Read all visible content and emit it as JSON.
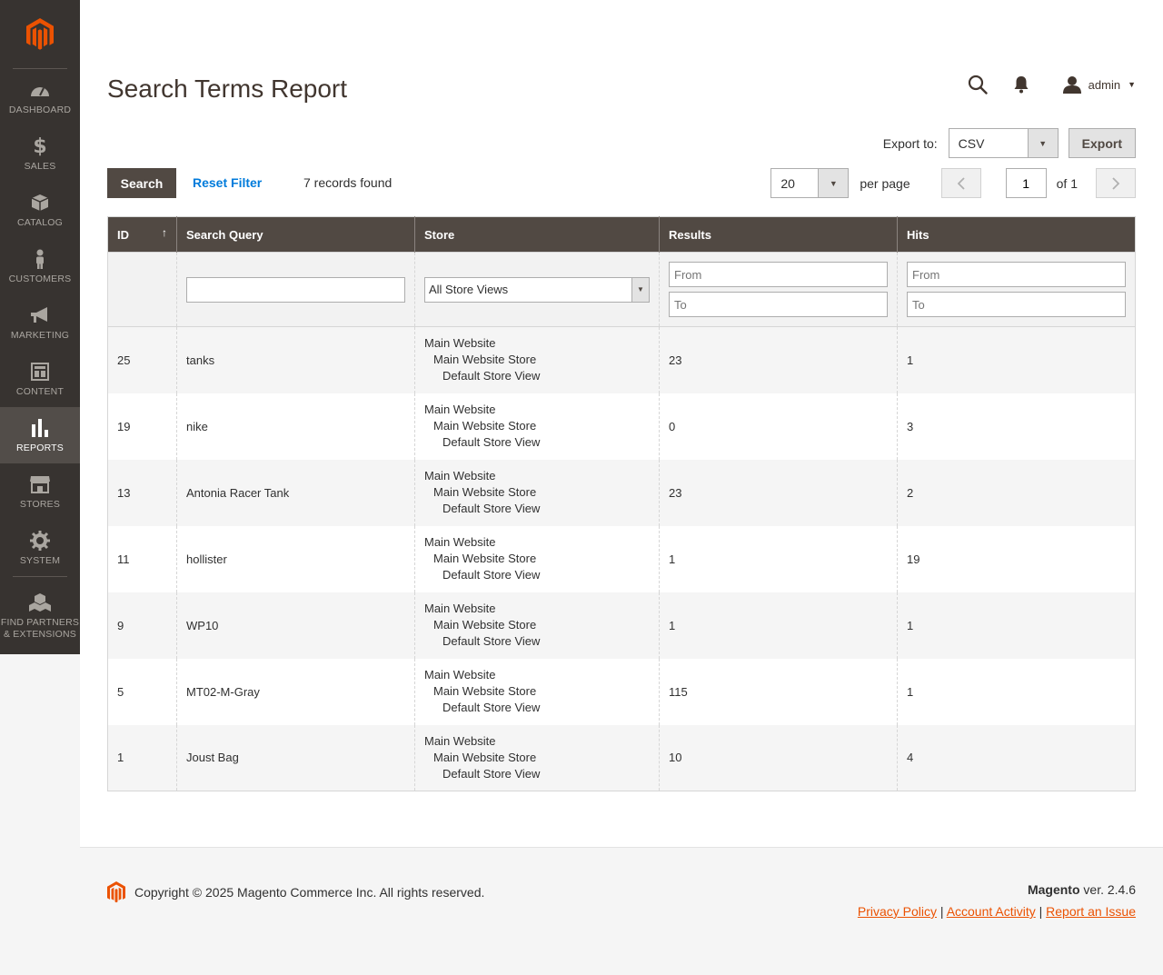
{
  "sidebar": {
    "items": [
      {
        "label": "Dashboard",
        "icon": "dashboard-icon"
      },
      {
        "label": "Sales",
        "icon": "dollar-icon"
      },
      {
        "label": "Catalog",
        "icon": "box-icon"
      },
      {
        "label": "Customers",
        "icon": "person-icon"
      },
      {
        "label": "Marketing",
        "icon": "megaphone-icon"
      },
      {
        "label": "Content",
        "icon": "layout-icon"
      },
      {
        "label": "Reports",
        "icon": "bar-chart-icon",
        "active": true
      },
      {
        "label": "Stores",
        "icon": "storefront-icon"
      },
      {
        "label": "System",
        "icon": "gear-icon"
      },
      {
        "label": "Find Partners & Extensions",
        "icon": "cubes-icon"
      }
    ]
  },
  "header": {
    "title": "Search Terms Report",
    "user": "admin"
  },
  "export": {
    "label": "Export to:",
    "format": "CSV",
    "button": "Export"
  },
  "toolbar": {
    "search_button": "Search",
    "reset_filter": "Reset Filter",
    "records_found": "7 records found",
    "per_page_value": "20",
    "per_page_label": "per page",
    "page_value": "1",
    "of_label": "of 1"
  },
  "grid": {
    "columns": [
      "ID",
      "Search Query",
      "Store",
      "Results",
      "Hits"
    ],
    "filters": {
      "store": "All Store Views",
      "from_placeholder": "From",
      "to_placeholder": "To"
    },
    "rows": [
      {
        "id": "25",
        "query": "tanks",
        "store": [
          "Main Website",
          "Main Website Store",
          "Default Store View"
        ],
        "results": "23",
        "hits": "1"
      },
      {
        "id": "19",
        "query": "nike",
        "store": [
          "Main Website",
          "Main Website Store",
          "Default Store View"
        ],
        "results": "0",
        "hits": "3"
      },
      {
        "id": "13",
        "query": "Antonia Racer Tank",
        "store": [
          "Main Website",
          "Main Website Store",
          "Default Store View"
        ],
        "results": "23",
        "hits": "2"
      },
      {
        "id": "11",
        "query": "hollister",
        "store": [
          "Main Website",
          "Main Website Store",
          "Default Store View"
        ],
        "results": "1",
        "hits": "19"
      },
      {
        "id": "9",
        "query": "WP10",
        "store": [
          "Main Website",
          "Main Website Store",
          "Default Store View"
        ],
        "results": "1",
        "hits": "1"
      },
      {
        "id": "5",
        "query": "MT02-M-Gray",
        "store": [
          "Main Website",
          "Main Website Store",
          "Default Store View"
        ],
        "results": "115",
        "hits": "1"
      },
      {
        "id": "1",
        "query": "Joust Bag",
        "store": [
          "Main Website",
          "Main Website Store",
          "Default Store View"
        ],
        "results": "10",
        "hits": "4"
      }
    ]
  },
  "footer": {
    "copyright": "Copyright © 2025 Magento Commerce Inc. All rights reserved.",
    "brand": "Magento",
    "version": " ver. 2.4.6",
    "links": [
      "Privacy Policy",
      "Account Activity",
      "Report an Issue"
    ]
  },
  "colors": {
    "accent": "#eb5202",
    "sidebar_bg": "#373330",
    "header_bg": "#514943",
    "link": "#007bdb"
  }
}
